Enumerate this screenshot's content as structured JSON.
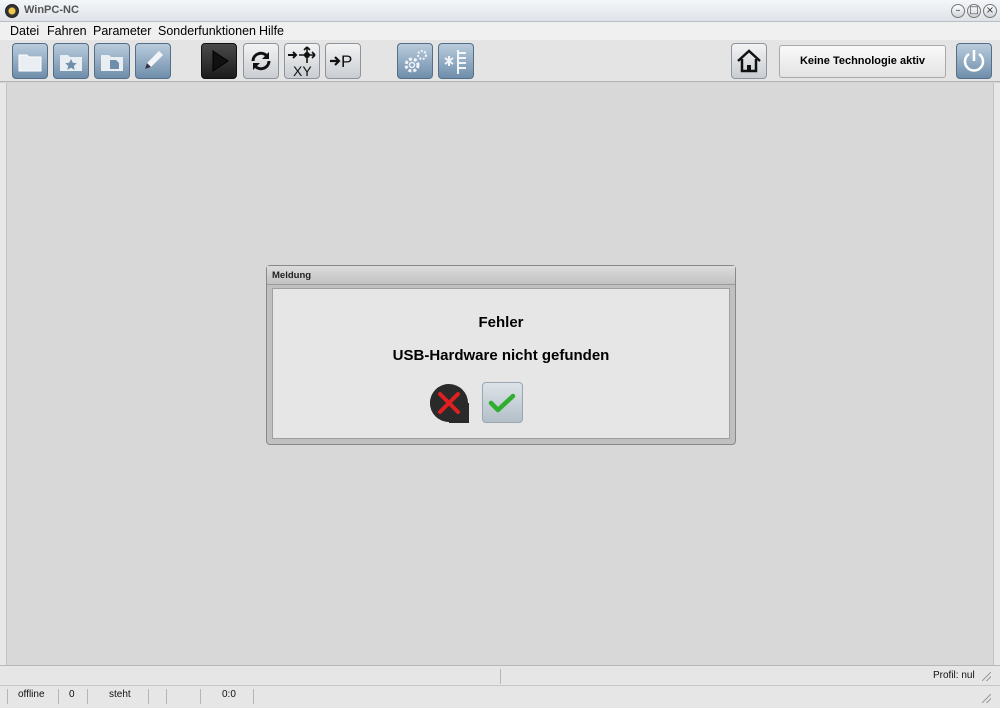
{
  "window": {
    "title": "WinPC-NC",
    "minimize_glyph": "–",
    "maximize_glyph": "□",
    "close_glyph": "×"
  },
  "menu": {
    "items": [
      {
        "label": "Datei"
      },
      {
        "label": "Fahren"
      },
      {
        "label": "Parameter"
      },
      {
        "label": "Sonderfunktionen"
      },
      {
        "label": "Hilfe"
      }
    ]
  },
  "toolbar": {
    "icons": [
      "open-folder-icon",
      "favorite-folder-icon",
      "file-folder-icon",
      "pencil-icon",
      "play-icon",
      "refresh-icon",
      "move-xy-icon",
      "move-park-icon",
      "settings-gears-icon",
      "parameter-list-icon",
      "home-icon",
      "power-icon"
    ],
    "move_xy_label": "XY",
    "move_park_label": "P",
    "technology_label": "Keine Technologie aktiv"
  },
  "dialog": {
    "title": "Meldung",
    "heading": "Fehler",
    "message": "USB-Hardware nicht gefunden"
  },
  "status": {
    "profile": "Profil: nul",
    "connection": "offline",
    "count": "0",
    "state": "steht",
    "position": "0:0"
  },
  "colors": {
    "accent_blue": "#6f8eab",
    "cancel_red": "#e02020",
    "ok_green": "#2fae2f"
  }
}
